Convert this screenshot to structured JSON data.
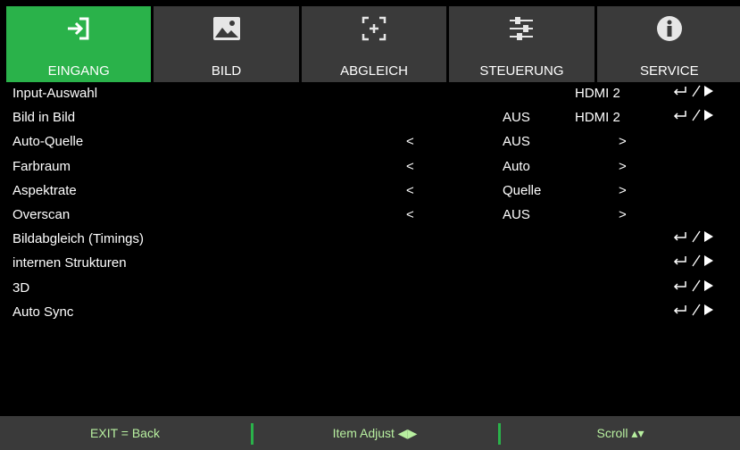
{
  "tabs": [
    {
      "label": "EINGANG",
      "icon": "input-icon",
      "active": true
    },
    {
      "label": "BILD",
      "icon": "image-icon",
      "active": false
    },
    {
      "label": "ABGLEICH",
      "icon": "alignment-icon",
      "active": false
    },
    {
      "label": "STEUERUNG",
      "icon": "sliders-icon",
      "active": false
    },
    {
      "label": "SERVICE",
      "icon": "info-icon",
      "active": false
    }
  ],
  "menu": {
    "rows": [
      {
        "label": "Input-Auswahl",
        "extra": "HDMI 2",
        "enter": true
      },
      {
        "label": "Bild in Bild",
        "value": "AUS",
        "extra": "HDMI 2",
        "enter": true
      },
      {
        "label": "Auto-Quelle",
        "left": "<",
        "value": "AUS",
        "right": ">"
      },
      {
        "label": "Farbraum",
        "left": "<",
        "value": "Auto",
        "right": ">"
      },
      {
        "label": "Aspektrate",
        "left": "<",
        "value": "Quelle",
        "right": ">"
      },
      {
        "label": "Overscan",
        "left": "<",
        "value": "AUS",
        "right": ">"
      },
      {
        "label": "Bildabgleich (Timings)",
        "enter": true
      },
      {
        "label": "internen Strukturen",
        "enter": true
      },
      {
        "label": "3D",
        "enter": true
      },
      {
        "label": "Auto Sync",
        "enter": true
      }
    ]
  },
  "footer": {
    "exit": "EXIT = Back",
    "adjust": "Item Adjust ◀▶",
    "scroll": "Scroll ▴▾"
  },
  "colors": {
    "accent": "#2ab24a",
    "tab_bg": "#3a3a3a",
    "footer_text": "#b8f0a0"
  }
}
